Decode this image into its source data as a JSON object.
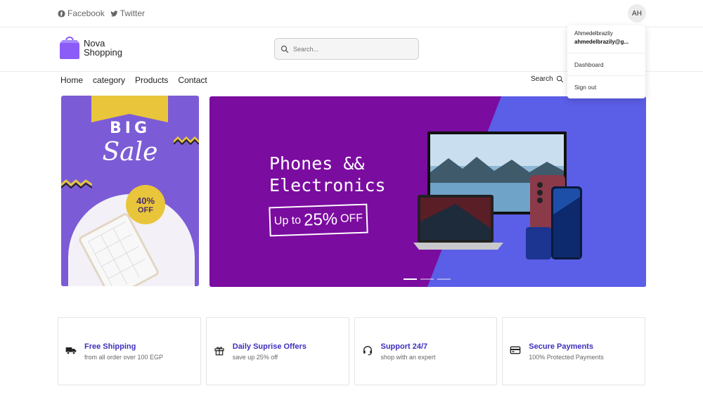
{
  "topbar": {
    "social": [
      {
        "label": "Facebook",
        "icon": "facebook-icon"
      },
      {
        "label": "Twitter",
        "icon": "twitter-icon"
      }
    ],
    "avatar_initials": "AH"
  },
  "header": {
    "logo_line1": "Nova",
    "logo_line2": "Shopping",
    "search_placeholder": "Search..."
  },
  "nav": {
    "links": [
      "Home",
      "category",
      "Products",
      "Contact"
    ],
    "search_label": "Search"
  },
  "user_menu": {
    "name": "Ahmedelbrazily",
    "email": "ahmedelbrazily@g...",
    "items": [
      "Dashboard",
      "Sign out"
    ]
  },
  "side_banner": {
    "big": "BIG",
    "sale": "Sale",
    "badge_pct": "40%",
    "badge_off": "OFF"
  },
  "main_banner": {
    "headline_line1": "Phones &&",
    "headline_line2": "Electronics",
    "offer_prefix": "Up to",
    "offer_pct": "25%",
    "offer_suffix": "OFF",
    "slides": 3,
    "active_slide": 1
  },
  "features": [
    {
      "title": "Free Shipping",
      "subtitle": "from all order over 100 EGP",
      "icon": "truck-icon"
    },
    {
      "title": "Daily Suprise Offers",
      "subtitle": "save up 25% off",
      "icon": "gift-icon"
    },
    {
      "title": "Support 24/7",
      "subtitle": "shop with an expert",
      "icon": "headset-icon"
    },
    {
      "title": "Secure Payments",
      "subtitle": "100% Protected Payments",
      "icon": "credit-card-icon"
    }
  ],
  "colors": {
    "brand_purple": "#8b5cf6",
    "banner_purple": "#7b0ca0",
    "banner_blue": "#5b5ee6",
    "feature_title": "#3e2fbd",
    "side_banner_bg": "#7b5cd6",
    "accent_yellow": "#e9c53b"
  }
}
